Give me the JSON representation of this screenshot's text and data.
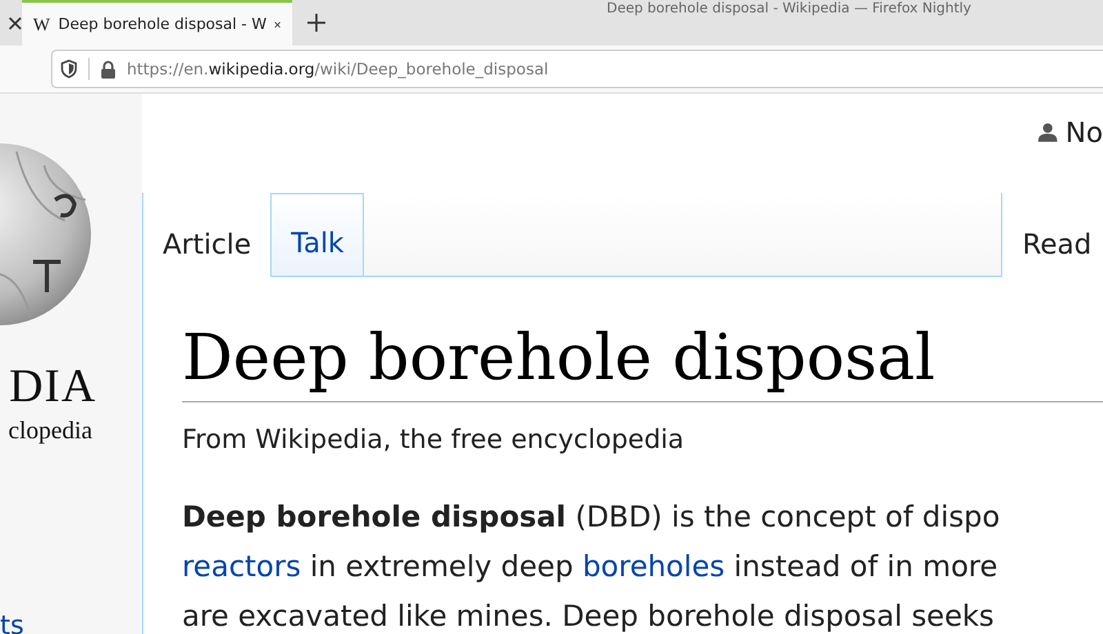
{
  "window": {
    "title": "Deep borehole disposal - Wikipedia — Firefox Nightly"
  },
  "browser_tabs": [
    {
      "selected": false
    },
    {
      "favicon": "W",
      "title": "Deep borehole disposal - W",
      "selected": true
    }
  ],
  "address_bar": {
    "url_prefix": "https://en.",
    "url_domain": "wikipedia.org",
    "url_path": "/wiki/Deep_borehole_disposal"
  },
  "logo": {
    "wordmark": "DIA",
    "tagline": "clopedia"
  },
  "sidebar_link": "ts",
  "user": {
    "label": "No"
  },
  "page_tabs": [
    {
      "label": "Article",
      "selected": true
    },
    {
      "label": "Talk",
      "selected": false
    }
  ],
  "view_tabs": [
    {
      "label": "Read",
      "selected": true
    }
  ],
  "heading": "Deep borehole disposal",
  "tagline": "From Wikipedia, the free encyclopedia",
  "paragraph_lines": [
    [
      {
        "kind": "bold",
        "text": "Deep borehole disposal"
      },
      {
        "kind": "plain",
        "text": " (DBD) is the concept of dispo"
      }
    ],
    [
      {
        "kind": "link",
        "text": "reactors"
      },
      {
        "kind": "plain",
        "text": " in extremely deep "
      },
      {
        "kind": "link",
        "text": "boreholes"
      },
      {
        "kind": "plain",
        "text": " instead of in more"
      }
    ],
    [
      {
        "kind": "plain",
        "text": "are excavated like mines. Deep borehole disposal seeks"
      }
    ]
  ]
}
